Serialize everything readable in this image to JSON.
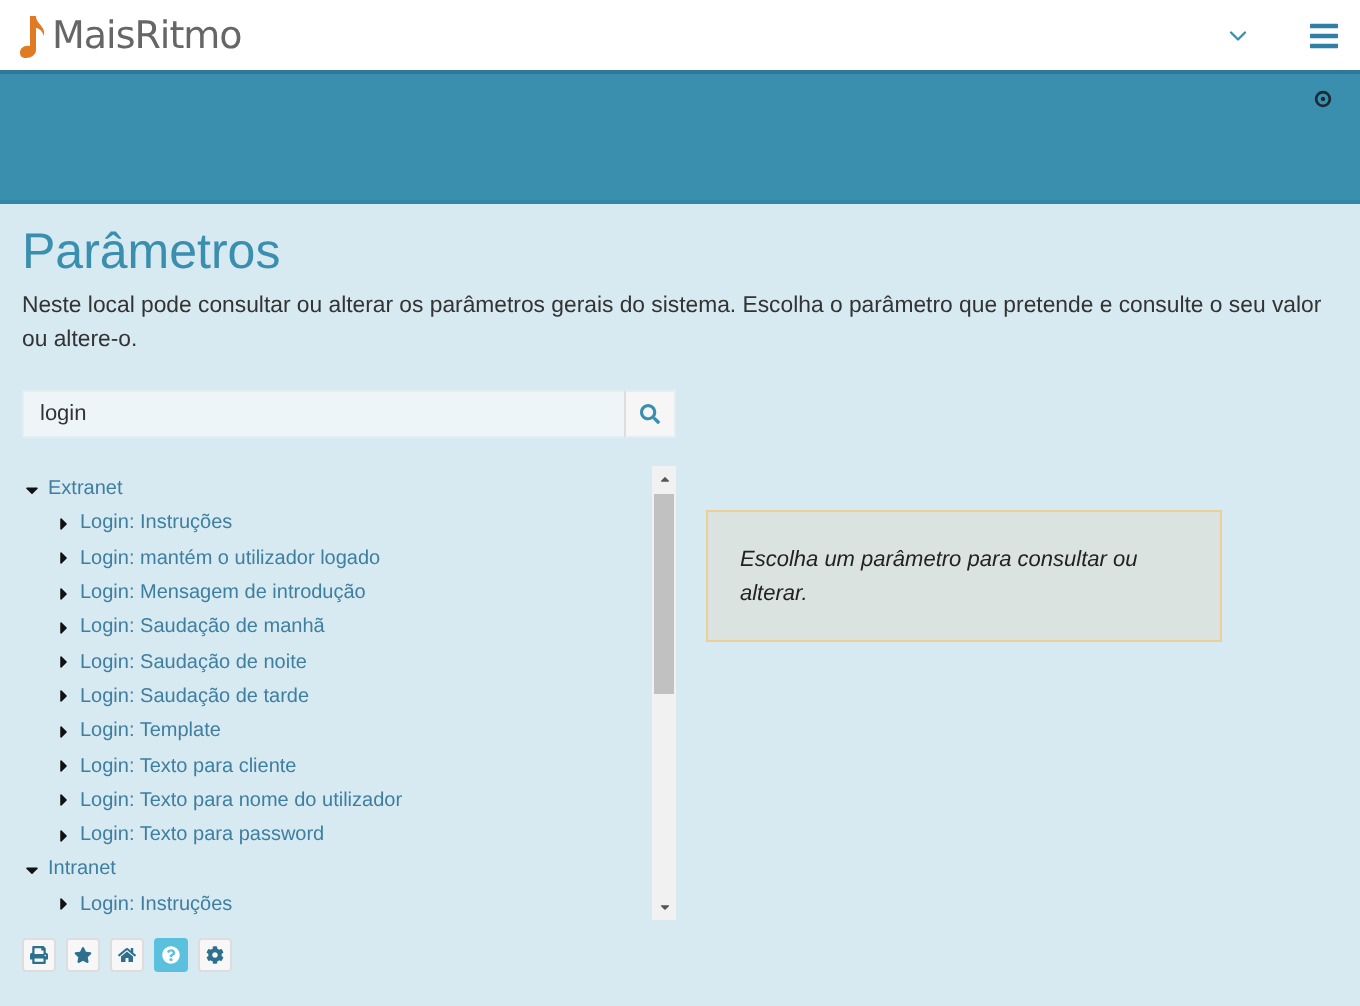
{
  "header": {
    "logo": "MaisRitmo"
  },
  "page": {
    "title": "Parâmetros",
    "description": "Neste local pode consultar ou alterar os parâmetros gerais do sistema. Escolha o parâmetro que pretende e consulte o seu valor ou altere-o."
  },
  "search": {
    "value": "login"
  },
  "tree": [
    {
      "label": "Extranet",
      "expanded": true,
      "children": [
        {
          "label": "Login: Instruções",
          "expanded": false
        },
        {
          "label": "Login: mantém o utilizador logado",
          "expanded": false
        },
        {
          "label": "Login: Mensagem de introdução",
          "expanded": false
        },
        {
          "label": "Login: Saudação de manhã",
          "expanded": false
        },
        {
          "label": "Login: Saudação de noite",
          "expanded": false
        },
        {
          "label": "Login: Saudação de tarde",
          "expanded": false
        },
        {
          "label": "Login: Template",
          "expanded": false
        },
        {
          "label": "Login: Texto para cliente",
          "expanded": false
        },
        {
          "label": "Login: Texto para nome do utilizador",
          "expanded": false
        },
        {
          "label": "Login: Texto para password",
          "expanded": false
        }
      ]
    },
    {
      "label": "Intranet",
      "expanded": true,
      "children": [
        {
          "label": "Login: Instruções",
          "expanded": false
        }
      ]
    }
  ],
  "message": "Escolha um parâmetro para consultar ou alterar.",
  "toolbar": [
    {
      "kind": "print",
      "selected": false
    },
    {
      "kind": "star",
      "selected": false
    },
    {
      "kind": "home",
      "selected": false
    },
    {
      "kind": "help",
      "selected": true
    },
    {
      "kind": "settings",
      "selected": false
    }
  ]
}
